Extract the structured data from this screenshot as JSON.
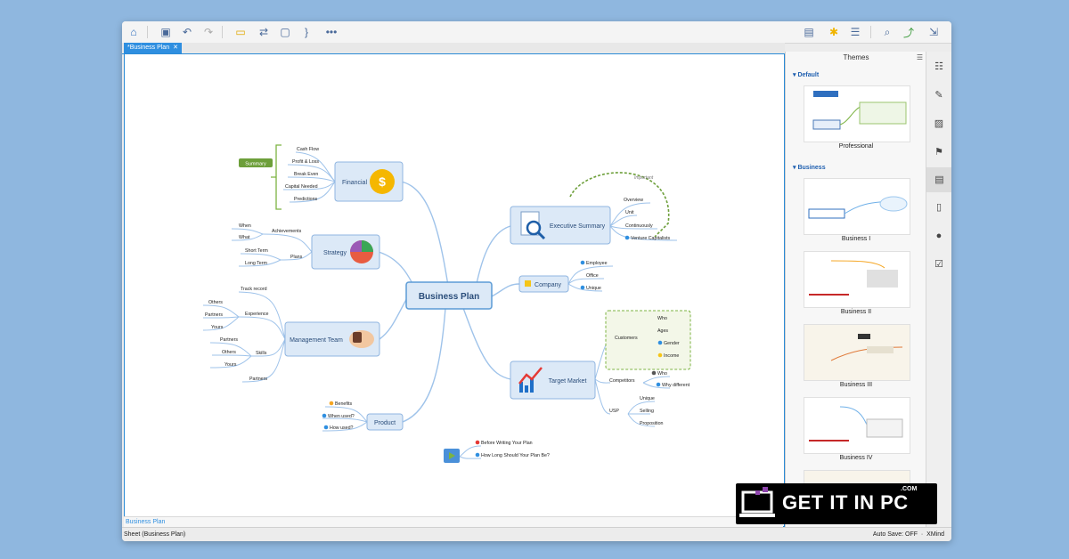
{
  "app": {
    "name": "XMind",
    "autosave": "Auto Save: OFF"
  },
  "tab": {
    "title": "*Business Plan",
    "close": "✕"
  },
  "sheet": {
    "tab_label": "Business Plan",
    "status": "Sheet (Business Plan)"
  },
  "themes_panel": {
    "title": "Themes",
    "groups": [
      {
        "label": "Default",
        "themes": [
          "Professional"
        ]
      },
      {
        "label": "Business",
        "themes": [
          "Business I",
          "Business II",
          "Business III",
          "Business IV"
        ]
      }
    ]
  },
  "mindmap": {
    "central": "Business Plan",
    "financial": {
      "label": "Financial",
      "summary": "Summary",
      "items": [
        "Cash Flow",
        "Profit & Loss",
        "Break Even",
        "Capital Needed",
        "Predictions"
      ]
    },
    "strategy": {
      "label": "Strategy",
      "achievements": "Achievements",
      "ach_items": [
        "When",
        "What"
      ],
      "plans": "Plans",
      "plan_items": [
        "Short Term",
        "Long Term"
      ]
    },
    "management": {
      "label": "Management Team",
      "track": "Track record",
      "experience": "Experience",
      "exp_items": [
        "Others",
        "Partners",
        "Yours"
      ],
      "skills": "Skills",
      "skill_items": [
        "Partners",
        "Others",
        "Yours"
      ],
      "partners": "Partners"
    },
    "product": {
      "label": "Product",
      "items": [
        "Benefits",
        "When used?",
        "How used?"
      ]
    },
    "executive": {
      "label": "Executive Summary",
      "items": [
        "Overview",
        "Unit",
        "Continuously",
        "Venture Capitalists"
      ],
      "relationship": "Important"
    },
    "company": {
      "label": "Company",
      "items": [
        "Employee",
        "Office",
        "Unique"
      ]
    },
    "target": {
      "label": "Target Market",
      "customers": "Customers",
      "cust_items": [
        "Who",
        "Ages",
        "Gender",
        "Income"
      ],
      "competitors": "Competitors",
      "comp_items": [
        "Who",
        "Why different"
      ],
      "usp": "USP",
      "usp_items": [
        "Unique",
        "Selling",
        "Proposition"
      ]
    },
    "floating": {
      "items": [
        "Before Writing Your Plan",
        "How Long Should Your Plan Be?"
      ]
    }
  },
  "watermark": {
    "text": "GET IT IN PC",
    "suffix": ".COM"
  }
}
